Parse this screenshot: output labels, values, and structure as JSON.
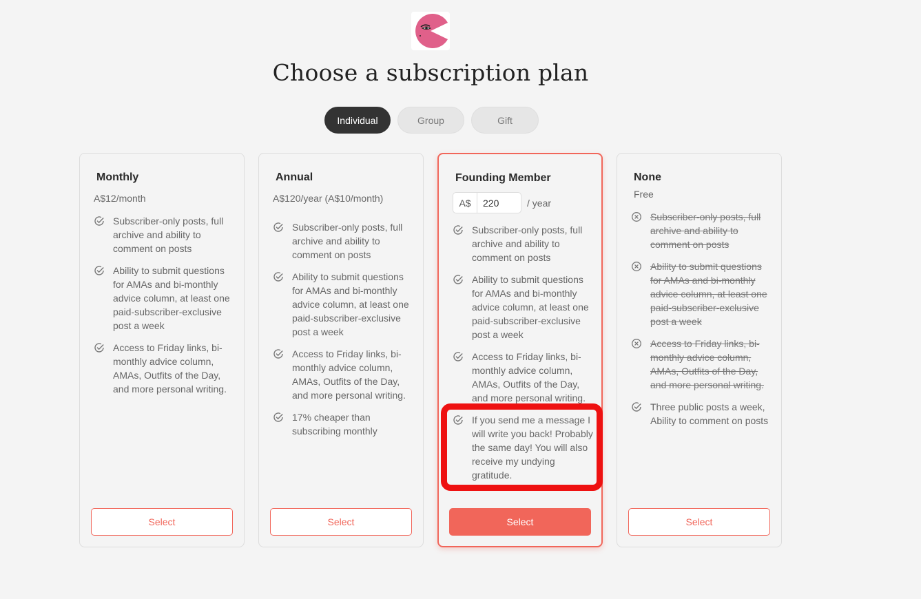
{
  "header": {
    "title": "Choose a subscription plan",
    "logo_icon": "pink-face-logo"
  },
  "tabs": [
    {
      "label": "Individual",
      "active": true
    },
    {
      "label": "Group",
      "active": false
    },
    {
      "label": "Gift",
      "active": false
    }
  ],
  "colors": {
    "accent": "#f1665a",
    "highlight_annotation": "#ee1111",
    "active_tab": "#333333",
    "logo_pink": "#e0608a"
  },
  "plans": {
    "monthly": {
      "name": "Monthly",
      "price": "A$12/month",
      "features": [
        "Subscriber-only posts, full archive and ability to comment on posts",
        "Ability to submit questions for AMAs and bi-monthly advice column, at least one paid-subscriber-exclusive post a week",
        "Access to Friday links, bi-monthly advice column, AMAs, Outfits of the Day, and more personal writing."
      ],
      "button": "Select"
    },
    "annual": {
      "name": "Annual",
      "price": "A$120/year (A$10/month)",
      "features": [
        "Subscriber-only posts, full archive and ability to comment on posts",
        "Ability to submit questions for AMAs and bi-monthly advice column, at least one paid-subscriber-exclusive post a week",
        "Access to Friday links, bi-monthly advice column, AMAs, Outfits of the Day, and more personal writing.",
        "17% cheaper than subscribing monthly"
      ],
      "button": "Select"
    },
    "founding": {
      "name": "Founding Member",
      "currency": "A$",
      "amount": "220",
      "period": "/ year",
      "features": [
        "Subscriber-only posts, full archive and ability to comment on posts",
        "Ability to submit questions for AMAs and bi-monthly advice column, at least one paid-subscriber-exclusive post a week",
        "Access to Friday links, bi-monthly advice column, AMAs, Outfits of the Day, and more personal writing.",
        "If you send me a message I will write you back! Probably the same day! You will also receive my undying gratitude."
      ],
      "button": "Select"
    },
    "none": {
      "name": "None",
      "price": "Free",
      "features": [
        {
          "text": "Subscriber-only posts, full archive and ability to comment on posts",
          "included": false
        },
        {
          "text": "Ability to submit questions for AMAs and bi-monthly advice column, at least one paid-subscriber-exclusive post a week",
          "included": false
        },
        {
          "text": "Access to Friday links, bi-monthly advice column, AMAs, Outfits of the Day, and more personal writing.",
          "included": false
        },
        {
          "text": "Three public posts a week, Ability to comment on posts",
          "included": true
        }
      ],
      "button": "Select"
    }
  }
}
